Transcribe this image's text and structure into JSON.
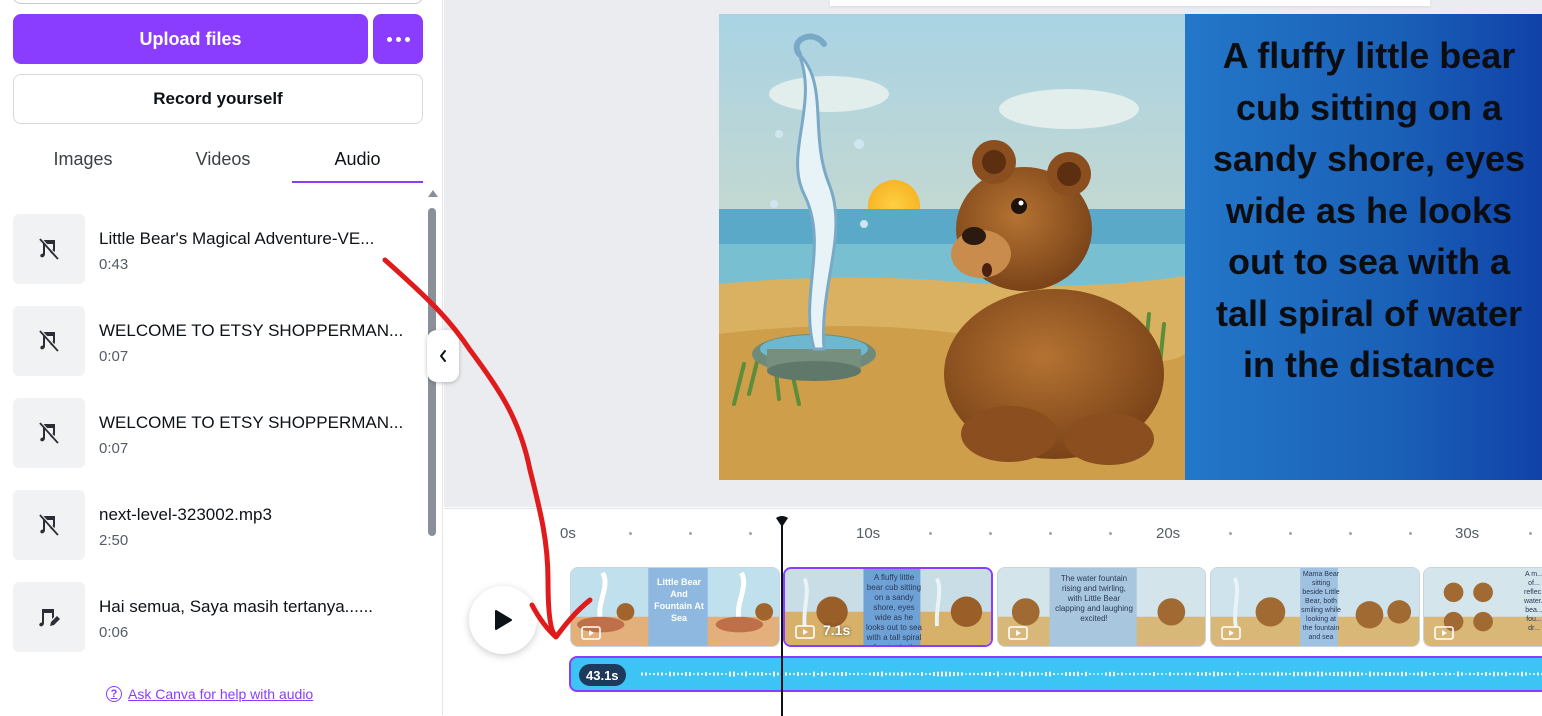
{
  "left_panel": {
    "upload_label": "Upload files",
    "record_label": "Record yourself",
    "tabs": [
      {
        "label": "Images",
        "active": false
      },
      {
        "label": "Videos",
        "active": false
      },
      {
        "label": "Audio",
        "active": true
      }
    ],
    "audio_items": [
      {
        "title": "Little Bear's Magical Adventure-VE...",
        "duration": "0:43",
        "icon": "audio-off-icon"
      },
      {
        "title": "WELCOME TO ETSY SHOPPERMAN...",
        "duration": "0:07",
        "icon": "audio-off-icon"
      },
      {
        "title": "WELCOME TO ETSY SHOPPERMAN...",
        "duration": "0:07",
        "icon": "audio-off-icon"
      },
      {
        "title": "next-level-323002.mp3",
        "duration": "2:50",
        "icon": "audio-off-icon"
      },
      {
        "title": "Hai semua, Saya masih tertanya......",
        "duration": "0:06",
        "icon": "audio-edit-icon"
      }
    ],
    "help_link": "Ask Canva for help with audio",
    "help_icon": "question-circle-icon"
  },
  "slide": {
    "text": "A fluffy little bear cub sitting on a sandy shore, eyes wide as he looks out to sea with a tall spiral of water in the distance",
    "panel_color": "#1a60b7"
  },
  "timeline": {
    "ruler": [
      "0s",
      "10s",
      "20s",
      "30s"
    ],
    "clips": [
      {
        "text": "Little Bear And Fountain At Sea",
        "duration": "",
        "selected": false
      },
      {
        "text": "A fluffy little bear cub sitting on a sandy shore, eyes wide as he looks out to sea with a tall spiral of water in the distance",
        "duration": "7.1s",
        "selected": true
      },
      {
        "text": "The water fountain rising and twirling, with Little Bear clapping and laughing excited!",
        "duration": "",
        "selected": false
      },
      {
        "text": "Mama Bear sitting beside Little Bear, both smiling while looking at the fountain and sea",
        "duration": "",
        "selected": false
      },
      {
        "text": "A m... of... reflec... water... bea... fou... dr...",
        "duration": "",
        "selected": false
      }
    ],
    "audio_duration": "43.1s"
  },
  "colors": {
    "accent": "#8b3dff",
    "audio_track": "#3cc4f4",
    "annotation": "#e01b1b"
  }
}
